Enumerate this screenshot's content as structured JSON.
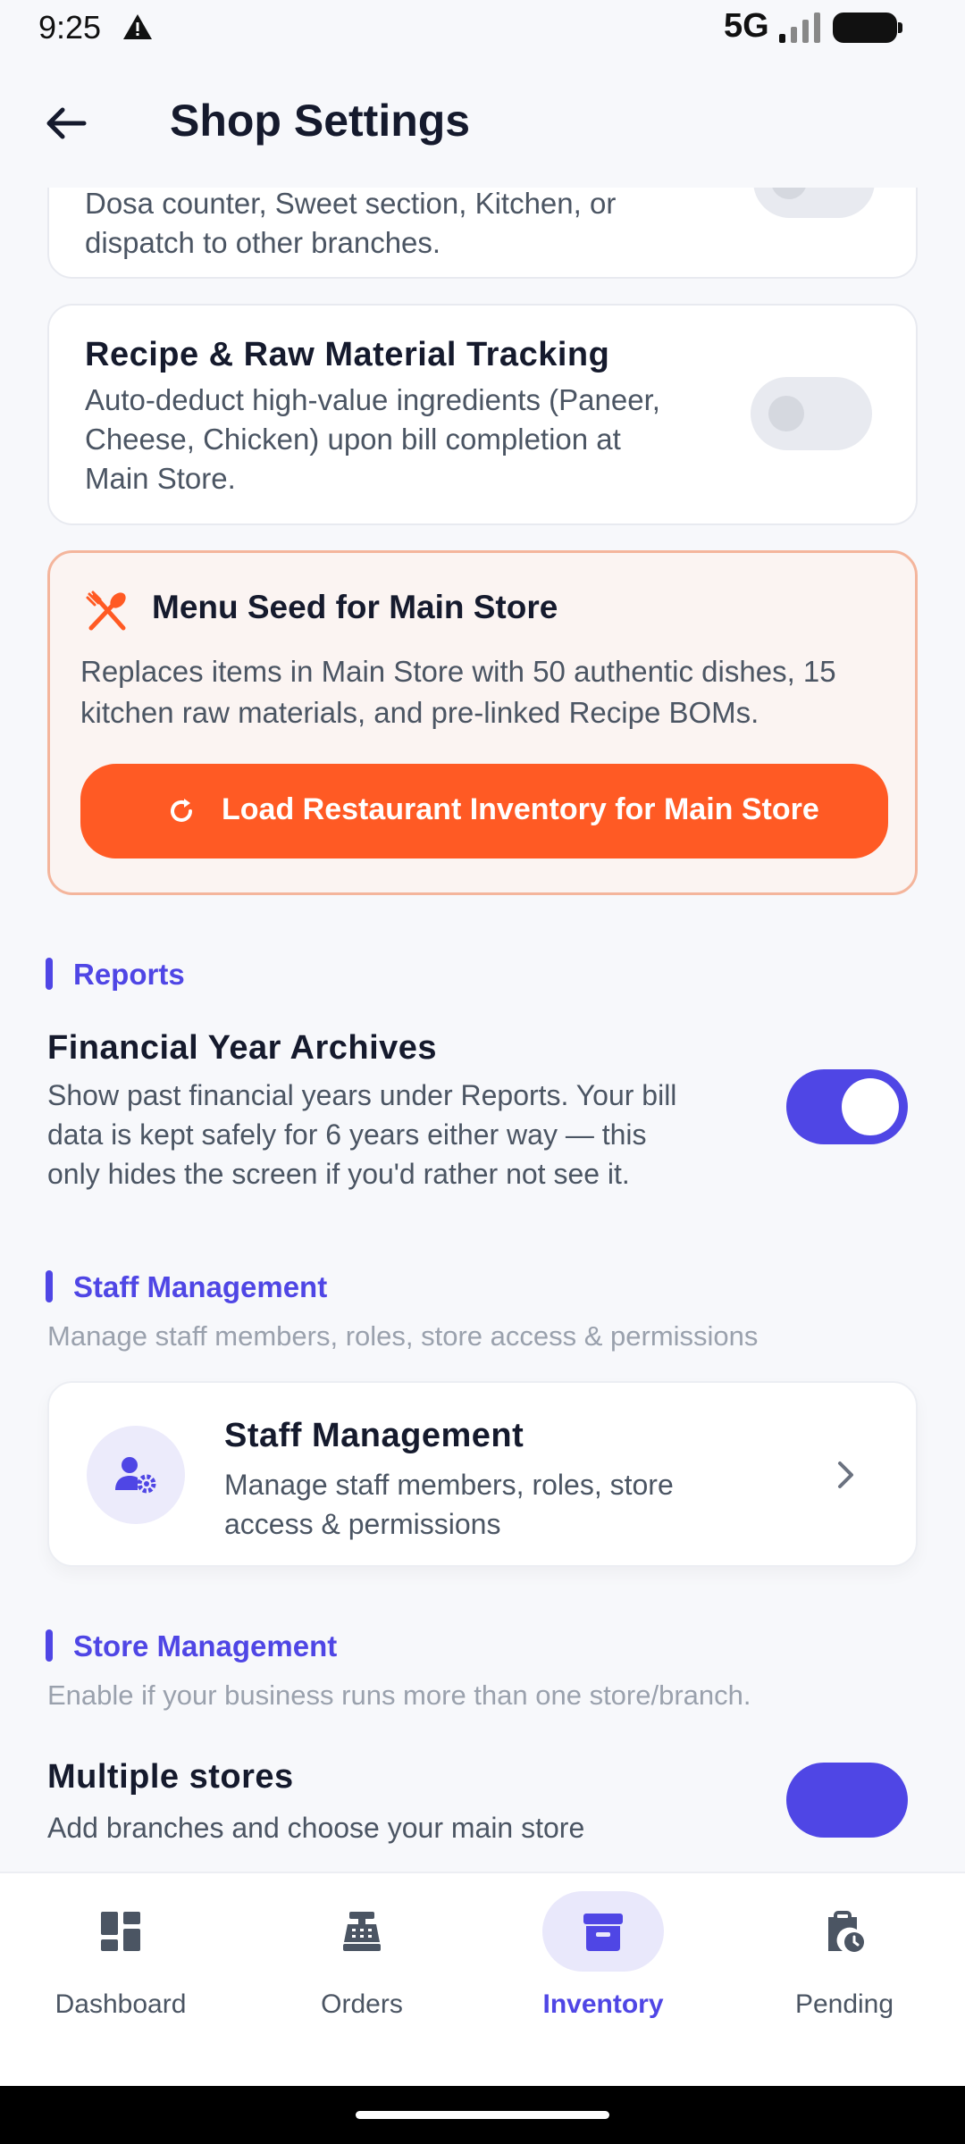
{
  "status": {
    "time": "9:25",
    "network": "5G"
  },
  "header": {
    "title": "Shop Settings"
  },
  "kitchen_card": {
    "description_partial": [
      "Dosa counter, Sweet section, Kitchen, or",
      "dispatch to other branches."
    ]
  },
  "recipe_card": {
    "title": "Recipe & Raw Material Tracking",
    "description": [
      "Auto-deduct high-value ingredients (Paneer,",
      "Cheese, Chicken) upon bill completion at",
      "Main Store."
    ],
    "enabled": false
  },
  "menu_seed": {
    "title": "Menu Seed for Main Store",
    "description": [
      "Replaces items in Main Store with 50 authentic dishes, 15",
      "kitchen raw materials, and pre-linked Recipe BOMs."
    ],
    "button_label": "Load Restaurant Inventory for Main Store"
  },
  "reports": {
    "section_title": "Reports",
    "fy_title": "Financial Year Archives",
    "fy_description": [
      "Show past financial years under Reports. Your bill",
      "data is kept safely for 6 years either way — this",
      "only hides the screen if you'd rather not see it."
    ],
    "fy_enabled": true
  },
  "staff": {
    "section_title": "Staff Management",
    "section_subtitle": "Manage staff members, roles, store access & permissions",
    "card_title": "Staff Management",
    "card_description": [
      "Manage staff members, roles, store",
      "access & permissions"
    ]
  },
  "store": {
    "section_title": "Store Management",
    "section_subtitle": "Enable if your business runs more than one store/branch.",
    "multi_title": "Multiple stores",
    "multi_description": "Add branches and choose your main store",
    "multi_enabled": true
  },
  "nav": {
    "items": [
      {
        "label": "Dashboard",
        "icon": "dashboard-icon"
      },
      {
        "label": "Orders",
        "icon": "cash-register-icon"
      },
      {
        "label": "Inventory",
        "icon": "archive-box-icon",
        "active": true
      },
      {
        "label": "Pending",
        "icon": "clipboard-clock-icon"
      }
    ]
  },
  "colors": {
    "accent": "#4f46e5",
    "seed_button": "#ff5a24",
    "seed_border": "#f4b59c"
  }
}
